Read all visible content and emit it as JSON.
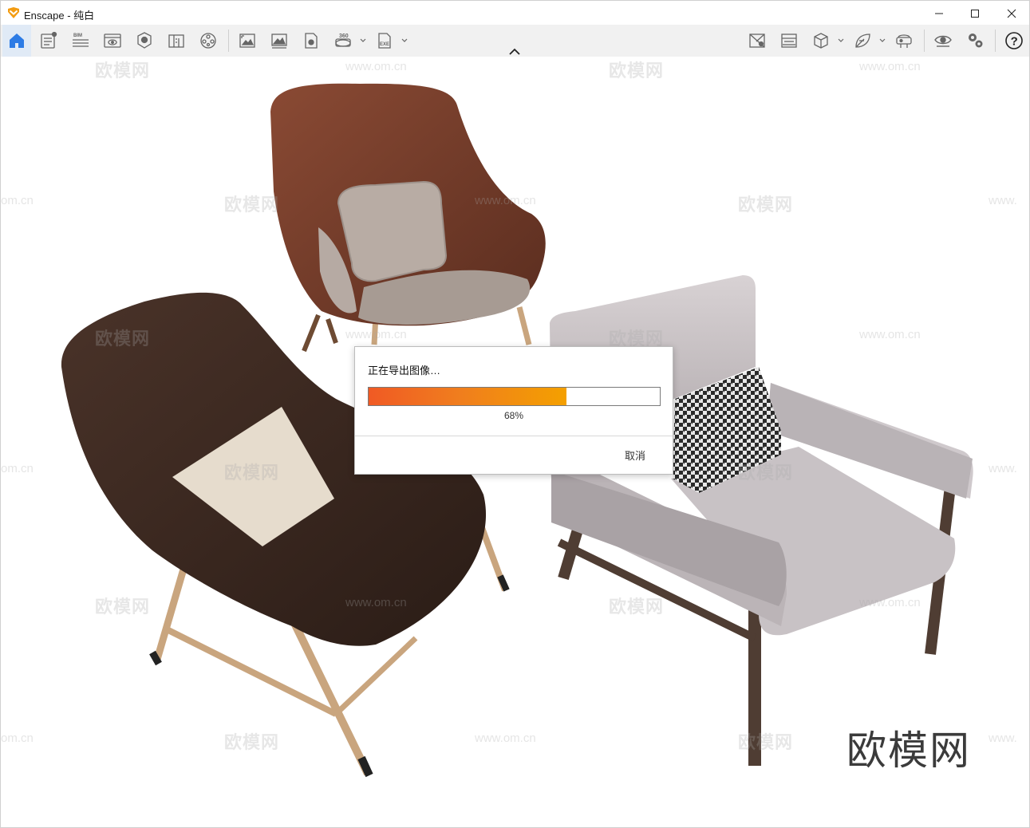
{
  "window": {
    "title": "Enscape - 纯白",
    "app_icon": "enscape-logo-icon",
    "controls": [
      "minimize-icon",
      "maximize-icon",
      "close-icon"
    ]
  },
  "toolbar": {
    "accent_color": "#2c7be5",
    "left_group": [
      {
        "name": "home-icon",
        "active": true
      },
      {
        "name": "asset-library-icon"
      },
      {
        "name": "bim-icon",
        "label": "BIM"
      },
      {
        "name": "view-management-icon"
      },
      {
        "name": "sun-light-icon"
      },
      {
        "name": "material-editor-icon"
      },
      {
        "name": "video-editor-icon"
      }
    ],
    "export_group": [
      {
        "name": "render-image-icon"
      },
      {
        "name": "batch-render-icon"
      },
      {
        "name": "export-panorama-icon"
      },
      {
        "name": "export-360-icon",
        "label": "360"
      },
      {
        "name": "export-exe-icon",
        "label": "EXE"
      }
    ],
    "right_group": [
      {
        "name": "visual-settings-icon"
      },
      {
        "name": "atmosphere-icon"
      },
      {
        "name": "cube-view-icon"
      },
      {
        "name": "leaf-collaboration-icon"
      },
      {
        "name": "vr-headset-icon"
      },
      {
        "name": "eye-preview-icon"
      },
      {
        "name": "gear-settings-icon"
      },
      {
        "name": "help-icon"
      }
    ]
  },
  "viewport": {
    "background": "#ffffff",
    "watermark_text": "欧模网",
    "watermark_url": "www.om.cn",
    "watermark_url_partial_left": "om.cn",
    "watermark_url_partial_right": "www.",
    "brand_mark": "欧模网"
  },
  "dialog": {
    "title": "正在导出图像…",
    "progress": 0.68,
    "progress_text": "68%",
    "cancel_label": "取消"
  }
}
